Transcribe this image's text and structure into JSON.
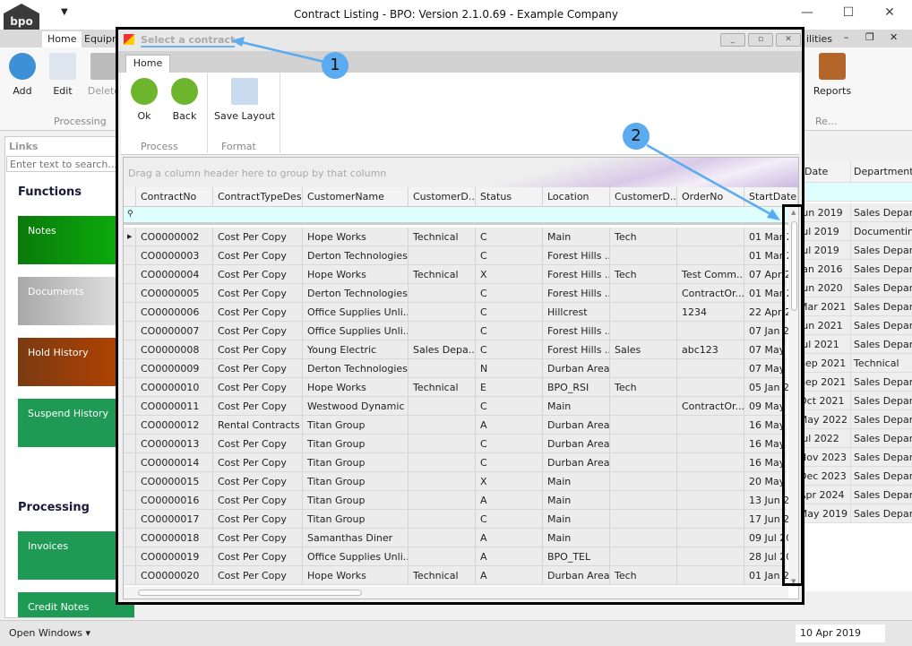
{
  "window": {
    "title": "Contract Listing - BPO: Version 2.1.0.69 - Example Company",
    "logo": "bpo",
    "quick_access": "▼",
    "minimize": "—",
    "maximize": "☐",
    "close": "✕"
  },
  "outer_ribbon": {
    "tabs": [
      "Home",
      "Equipm",
      "ilities"
    ],
    "buttons": {
      "add": "Add",
      "edit": "Edit",
      "delete": "Delete",
      "reports": "Reports"
    },
    "groups": {
      "processing": "Processing",
      "reports": "Re..."
    },
    "mdi": {
      "min": "–",
      "restore": "❐",
      "close": "✕"
    }
  },
  "left_panel": {
    "title": "Links",
    "search_placeholder": "Enter text to search...",
    "functions_heading": "Functions",
    "processing_heading": "Processing",
    "tiles": [
      {
        "label": "Notes",
        "color": "#0a8a0a"
      },
      {
        "label": "Documents",
        "color": "#aaaaaa"
      },
      {
        "label": "Hold History",
        "color": "#8b3a0a"
      },
      {
        "label": "Suspend History",
        "color": "#1f9a55"
      },
      {
        "label": "Invoices",
        "color": "#1f9a55"
      },
      {
        "label": "Credit Notes",
        "color": "#1f9a55"
      }
    ]
  },
  "background_grid": {
    "headers": [
      "Date",
      "DepartmentN"
    ],
    "rows": [
      [
        "Jun 2019",
        "Sales Department"
      ],
      [
        "Jul 2019",
        "Documenting"
      ],
      [
        "Jul 2019",
        "Sales Department"
      ],
      [
        "Jan 2016",
        "Sales Department"
      ],
      [
        "Jun 2020",
        "Sales Department"
      ],
      [
        "Mar 2021",
        "Sales Department"
      ],
      [
        "Jun 2021",
        "Sales Department"
      ],
      [
        "Jul 2021",
        "Sales Department"
      ],
      [
        "Sep 2021",
        "Technical"
      ],
      [
        "Sep 2021",
        "Sales Department"
      ],
      [
        "Oct 2021",
        "Sales Department"
      ],
      [
        "May 2022",
        "Sales Department"
      ],
      [
        "Jul 2022",
        "Sales Department"
      ],
      [
        "Nov 2023",
        "Sales Department"
      ],
      [
        "Dec 2023",
        "Sales Department"
      ],
      [
        "Apr 2024",
        "Sales Department"
      ],
      [
        "May 2019",
        "Sales Department"
      ]
    ]
  },
  "status_bar": {
    "open_windows": "Open Windows ▾",
    "date": "10 Apr 2019"
  },
  "dialog": {
    "title": "Select a contract",
    "tab": "Home",
    "buttons": {
      "ok": "Ok",
      "back": "Back",
      "save_layout": "Save Layout"
    },
    "groups": {
      "process": "Process",
      "format": "Format"
    },
    "group_panel_text": "Drag a column header here to group by that column",
    "columns": [
      "ContractNo",
      "ContractTypeDesc",
      "CustomerName",
      "CustomerD...",
      "Status",
      "Location",
      "CustomerD...",
      "OrderNo",
      "StartDate"
    ],
    "rows": [
      [
        "CO0000002",
        "Cost Per Copy",
        "Hope Works",
        "Technical",
        "C",
        "Main",
        "Tech",
        "",
        "01 Mar 2"
      ],
      [
        "CO0000003",
        "Cost Per Copy",
        "Derton Technologies",
        "",
        "C",
        "Forest Hills ...",
        "",
        "",
        "01 Mar 2"
      ],
      [
        "CO0000004",
        "Cost Per Copy",
        "Hope Works",
        "Technical",
        "X",
        "Forest Hills ...",
        "Tech",
        "Test Comm...",
        "07 Apr 2"
      ],
      [
        "CO0000005",
        "Cost Per Copy",
        "Derton Technologies",
        "",
        "C",
        "Forest Hills ...",
        "",
        "ContractOr...",
        "01 Mar 2"
      ],
      [
        "CO0000006",
        "Cost Per Copy",
        "Office Supplies Unli...",
        "",
        "C",
        "Hillcrest",
        "",
        "1234",
        "22 Apr 2"
      ],
      [
        "CO0000007",
        "Cost Per Copy",
        "Office Supplies Unli...",
        "",
        "C",
        "Forest Hills ...",
        "",
        "",
        "07 Jan 2"
      ],
      [
        "CO0000008",
        "Cost Per Copy",
        "Young Electric",
        "Sales Depa...",
        "C",
        "Forest Hills ...",
        "Sales",
        "abc123",
        "07 May"
      ],
      [
        "CO0000009",
        "Cost Per Copy",
        "Derton Technologies",
        "",
        "N",
        "Durban Area",
        "",
        "",
        "07 May"
      ],
      [
        "CO0000010",
        "Cost Per Copy",
        "Hope Works",
        "Technical",
        "E",
        "BPO_RSI",
        "Tech",
        "",
        "05 Jan 2"
      ],
      [
        "CO0000011",
        "Cost Per Copy",
        "Westwood Dynamic",
        "",
        "C",
        "Main",
        "",
        "ContractOr...",
        "09 May"
      ],
      [
        "CO0000012",
        "Rental Contracts",
        "Titan Group",
        "",
        "A",
        "Durban Area",
        "",
        "",
        "16 May"
      ],
      [
        "CO0000013",
        "Cost Per Copy",
        "Titan Group",
        "",
        "C",
        "Durban Area",
        "",
        "",
        "16 May"
      ],
      [
        "CO0000014",
        "Cost Per Copy",
        "Titan Group",
        "",
        "C",
        "Durban Area",
        "",
        "",
        "16 May"
      ],
      [
        "CO0000015",
        "Cost Per Copy",
        "Titan Group",
        "",
        "X",
        "Main",
        "",
        "",
        "20 May"
      ],
      [
        "CO0000016",
        "Cost Per Copy",
        "Titan Group",
        "",
        "A",
        "Main",
        "",
        "",
        "13 Jun 2"
      ],
      [
        "CO0000017",
        "Cost Per Copy",
        "Titan Group",
        "",
        "C",
        "Main",
        "",
        "",
        "17 Jun 2"
      ],
      [
        "CO0000018",
        "Cost Per Copy",
        "Samanthas Diner",
        "",
        "A",
        "Main",
        "",
        "",
        "09 Jul 20"
      ],
      [
        "CO0000019",
        "Cost Per Copy",
        "Office Supplies Unli...",
        "",
        "A",
        "BPO_TEL",
        "",
        "",
        "28 Jul 20"
      ],
      [
        "CO0000020",
        "Cost Per Copy",
        "Hope Works",
        "Technical",
        "A",
        "Durban Area",
        "Tech",
        "",
        "01 Jan 2"
      ]
    ]
  },
  "annotations": {
    "callout_1": "1",
    "callout_2": "2",
    "color": "#5aabf0"
  }
}
